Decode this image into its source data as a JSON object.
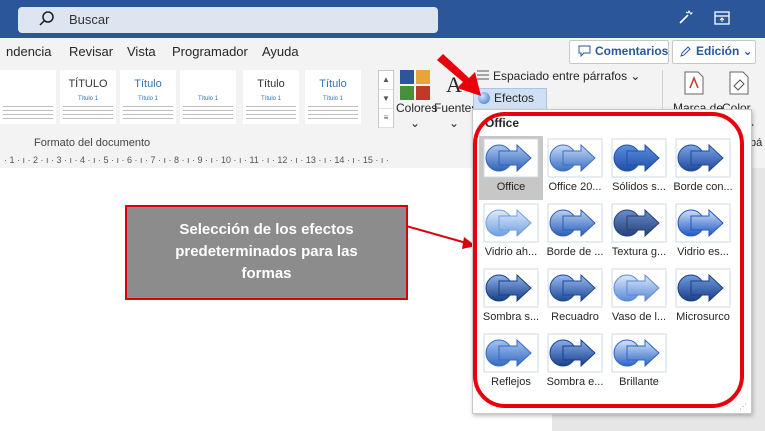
{
  "search": {
    "placeholder": "Buscar"
  },
  "tabs": [
    "ndencia",
    "Revisar",
    "Vista",
    "Programador",
    "Ayuda"
  ],
  "buttons": {
    "comments": "Comentarios",
    "editing": "Edición ⌄"
  },
  "styles": [
    {
      "title": "",
      "subtitle": "",
      "title_color": "#333333"
    },
    {
      "title": "TÍTULO",
      "subtitle": "Título 1",
      "title_color": "#333333"
    },
    {
      "title": "Título",
      "subtitle": "Título 1",
      "title_color": "#2e74b5"
    },
    {
      "title": "",
      "subtitle": "Título 1",
      "title_color": "#333333"
    },
    {
      "title": "Título",
      "subtitle": "Título 1",
      "title_color": "#333333"
    },
    {
      "title": "Título",
      "subtitle": "Título 1",
      "title_color": "#2e74b5"
    }
  ],
  "ribbon": {
    "colores": "Colores",
    "fuentes": "Fuentes",
    "espaciado": "Espaciado entre párrafos ⌄",
    "efectos": "Efectos ⌄",
    "marca": "Marca de",
    "color": "Color de",
    "format_label": "Formato del documento",
    "partial_a": "a ⌄",
    "partial_pa": "pá"
  },
  "ruler_text": "· 1 · ı · 2 · ı · 3 · ı · 4 · ı · 5 · ı · 6 · ı · 7 · ı · 8 · ı · 9 · ı · 10 · ı · 11 · ı · 12 · ı · 13 · ı · 14 · ı · 15 · ı ·",
  "dropdown": {
    "header": "Office",
    "effects": [
      {
        "label": "Office",
        "style": "office",
        "selected": true
      },
      {
        "label": "Office 20...",
        "style": "office2",
        "selected": false
      },
      {
        "label": "Sólidos s...",
        "style": "solid",
        "selected": false
      },
      {
        "label": "Borde con...",
        "style": "border",
        "selected": false
      },
      {
        "label": "Vidrio ah...",
        "style": "glass",
        "selected": false
      },
      {
        "label": "Borde de ...",
        "style": "edge",
        "selected": false
      },
      {
        "label": "Textura g...",
        "style": "texture",
        "selected": false
      },
      {
        "label": "Vidrio es...",
        "style": "glass2",
        "selected": false
      },
      {
        "label": "Sombra s...",
        "style": "shadow",
        "selected": false
      },
      {
        "label": "Recuadro",
        "style": "frame",
        "selected": false
      },
      {
        "label": "Vaso de l...",
        "style": "vase",
        "selected": false
      },
      {
        "label": "Microsurco",
        "style": "groove",
        "selected": false
      },
      {
        "label": "Reflejos",
        "style": "reflect",
        "selected": false
      },
      {
        "label": "Sombra e...",
        "style": "shadow2",
        "selected": false
      },
      {
        "label": "Brillante",
        "style": "bright",
        "selected": false
      }
    ]
  },
  "callout": {
    "line1": "Selección de los efectos",
    "line2": "predeterminados para las",
    "line3": "formas"
  },
  "colors": {
    "accent": "#2b579a",
    "red": "#e8000b",
    "shape_blue": "#4a7fd6"
  }
}
